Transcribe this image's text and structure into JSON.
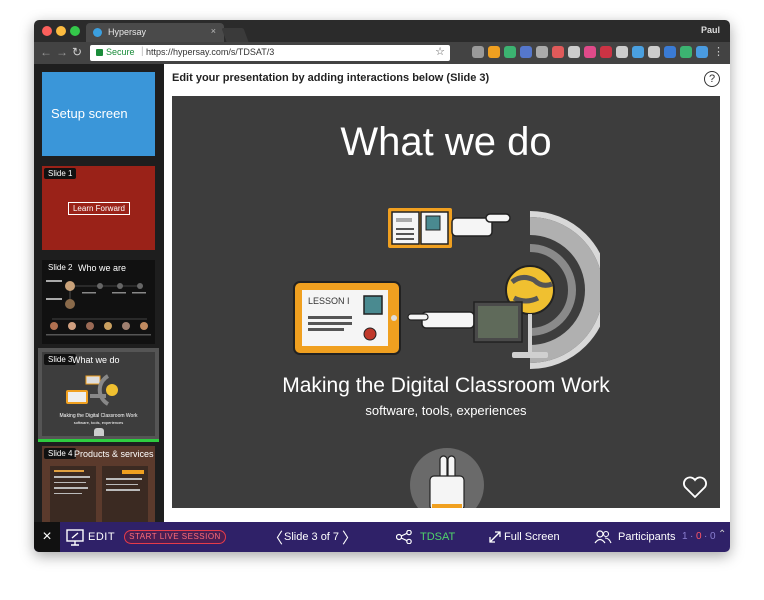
{
  "browser": {
    "tab_title": "Hypersay",
    "tab_close": "×",
    "profile_name": "Paul",
    "secure_label": "Secure",
    "url_separator": "|",
    "url": "https://hypersay.com/s/TDSAT/3",
    "url_domain": "hypersay.com",
    "back_glyph": "←",
    "forward_glyph": "→",
    "reload_glyph": "↻",
    "star_glyph": "☆",
    "menu_glyph": "⋮",
    "extension_colors": [
      "#9a9a9a",
      "#f0a020",
      "#3cb371",
      "#5577cc",
      "#aaaaaa",
      "#e05a5a",
      "#cccccc",
      "#e04a8a",
      "#cc3344",
      "#cccccc",
      "#4aa0e0",
      "#cccccc",
      "#3a7bd5",
      "#3cb371",
      "#4a9be0"
    ]
  },
  "sidebar": {
    "setup_label": "Setup screen",
    "slides": [
      {
        "badge": "Slide 1",
        "content": "Learn Forward"
      },
      {
        "badge": "Slide 2",
        "title": "Who we are"
      },
      {
        "badge": "Slide 3",
        "title": "What we do",
        "sub1": "Making the Digital Classroom Work",
        "sub2": "software, tools, experiences"
      },
      {
        "badge": "Slide 4",
        "title": "Products & services"
      }
    ],
    "active_slide_index": 2
  },
  "main": {
    "heading": "Edit your presentation by adding interactions below (Slide 3)",
    "help_glyph": "?",
    "slide": {
      "title": "What we do",
      "subtitle": "Making the Digital Classroom Work",
      "tagline": "software, tools, experiences",
      "lesson_label": "LESSON I",
      "lesson_label_small": "LESSON I"
    }
  },
  "bottom_bar": {
    "close_glyph": "×",
    "edit_label": "EDIT",
    "live_label": "START LIVE SESSION",
    "prev_glyph": "〈",
    "slide_counter": "Slide 3 of 7",
    "next_glyph": "〉",
    "session_code": "TDSAT",
    "fullscreen_label": "Full Screen",
    "participants_label": "Participants",
    "count_1": "1",
    "count_2": "0",
    "count_3": "0",
    "dot": "·",
    "chevron_glyph": "⌃"
  },
  "colors": {
    "bottom_bar": "#2f2168",
    "live_accent": "#e63b4a",
    "code_green": "#4fd36a",
    "setup_blue": "#3a96d9",
    "slide_bg": "#3d3d3d",
    "illustration_orange": "#f0a020"
  }
}
